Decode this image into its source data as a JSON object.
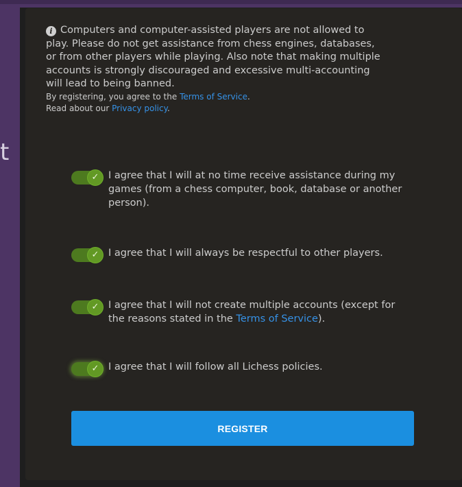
{
  "edge_glyph": "t",
  "warning": {
    "icon": "info-icon",
    "text": "Computers and computer-assisted players are not allowed to play. Please do not get assistance from chess engines, databases, or from other players while playing. Also note that making multiple accounts is strongly discouraged and excessive multi-accounting will lead to being banned.",
    "tos_prefix": "By registering, you agree to the ",
    "tos_link": "Terms of Service",
    "tos_suffix": ".",
    "privacy_prefix": "Read about our ",
    "privacy_link": "Privacy policy",
    "privacy_suffix": "."
  },
  "agreements": [
    {
      "checked": true,
      "text": "I agree that I will at no time receive assistance during my games (from a chess computer, book, database or another person)."
    },
    {
      "checked": true,
      "text": "I agree that I will always be respectful to other players."
    },
    {
      "checked": true,
      "text_prefix": "I agree that I will not create multiple accounts (except for the reasons stated in the ",
      "link": "Terms of Service",
      "text_suffix": ")."
    },
    {
      "checked": true,
      "text": "I agree that I will follow all Lichess policies."
    }
  ],
  "register_label": "REGISTER",
  "colors": {
    "background": "#4d3464",
    "panel": "#262421",
    "link": "#3692e7",
    "toggle_on": "#629924",
    "button": "#1b8fe0"
  }
}
